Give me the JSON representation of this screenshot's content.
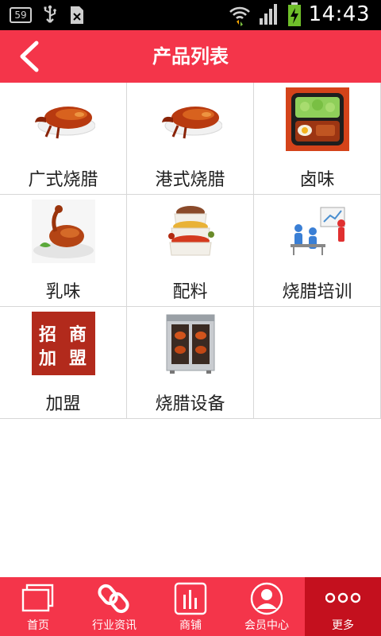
{
  "status_bar": {
    "notification_badge": "59",
    "time": "14:43"
  },
  "header": {
    "title": "产品列表"
  },
  "products": [
    {
      "label": "广式烧腊",
      "icon": "roast-duck-image"
    },
    {
      "label": "港式烧腊",
      "icon": "roast-duck-image"
    },
    {
      "label": "卤味",
      "icon": "bento-box-image"
    },
    {
      "label": "乳味",
      "icon": "roast-pigeon-image"
    },
    {
      "label": "配料",
      "icon": "spice-bags-image"
    },
    {
      "label": "烧腊培训",
      "icon": "training-class-image"
    },
    {
      "label": "加盟",
      "icon": "franchise-sign-image",
      "sign_text": [
        "招",
        "商",
        "加",
        "盟"
      ]
    },
    {
      "label": "烧腊设备",
      "icon": "roasting-oven-image"
    }
  ],
  "bottom_nav": [
    {
      "label": "首页",
      "icon": "home-icon",
      "active": false
    },
    {
      "label": "行业资讯",
      "icon": "link-icon",
      "active": false
    },
    {
      "label": "商铺",
      "icon": "store-icon",
      "active": false
    },
    {
      "label": "会员中心",
      "icon": "user-icon",
      "active": false
    },
    {
      "label": "更多",
      "icon": "more-icon",
      "active": true
    }
  ],
  "colors": {
    "accent": "#f4354a",
    "active_nav": "#c4101e",
    "grid_line": "#d7d7d7"
  }
}
